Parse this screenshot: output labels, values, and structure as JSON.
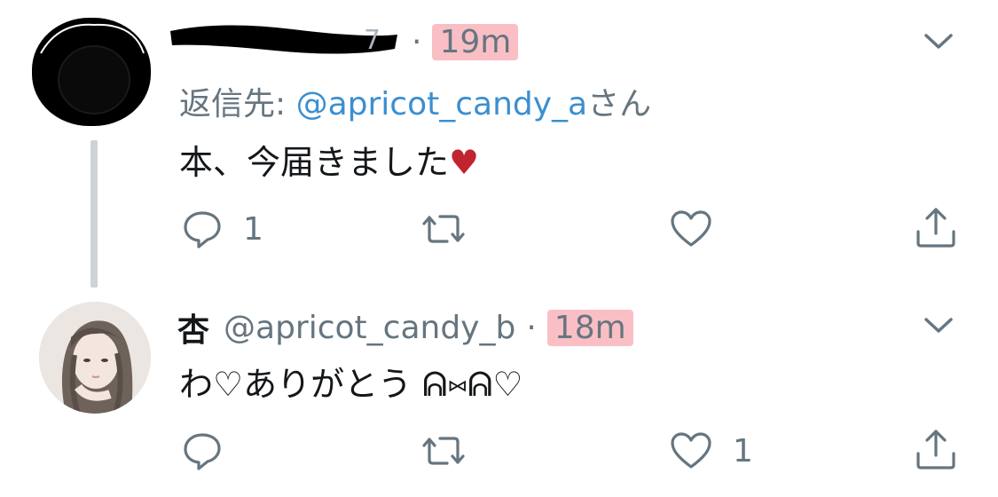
{
  "tweets": [
    {
      "display_name": "",
      "handle_redacted": true,
      "timestamp": "19m",
      "reply_to_prefix": "返信先: ",
      "reply_to_handle": "@apricot_candy_a",
      "reply_to_suffix": "さん",
      "text": "本、今届きました",
      "text_emoji": "♥",
      "actions": {
        "reply_count": "1",
        "retweet_count": "",
        "like_count": ""
      }
    },
    {
      "display_name": "杏",
      "handle": "@apricot_candy_b",
      "timestamp": "18m",
      "text": "わ♡ありがとう ᕱ⑅ᕱ♡",
      "actions": {
        "reply_count": "",
        "retweet_count": "",
        "like_count": "1"
      }
    }
  ],
  "separator": "·",
  "colors": {
    "secondary_text": "#66757f",
    "link": "#3b8fd0",
    "timestamp_highlight": "#f48a96",
    "thread_line": "#cfd3d8",
    "heart_emoji": "#c0242e"
  },
  "icons": [
    "chevron-down-icon",
    "reply-icon",
    "retweet-icon",
    "like-icon",
    "share-icon"
  ]
}
